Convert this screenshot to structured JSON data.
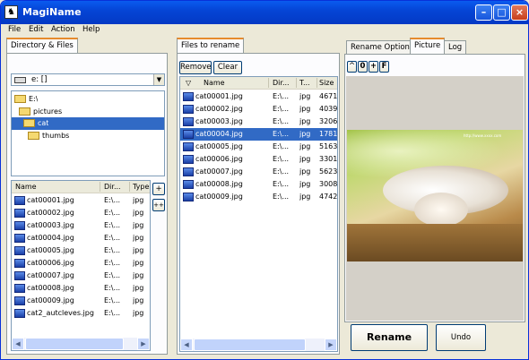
{
  "window": {
    "title": "MagiName"
  },
  "menu": [
    "File",
    "Edit",
    "Action",
    "Help"
  ],
  "left": {
    "tab": "Directory & Files",
    "drive": "e: []",
    "tree": [
      {
        "label": "E:\\"
      },
      {
        "label": "pictures"
      },
      {
        "label": "cat"
      },
      {
        "label": "thumbs"
      }
    ],
    "columns": [
      "Name",
      "Dir...",
      "Type"
    ],
    "files": [
      {
        "name": "cat00001.jpg",
        "dir": "E:\\...",
        "type": "jpg"
      },
      {
        "name": "cat00002.jpg",
        "dir": "E:\\...",
        "type": "jpg"
      },
      {
        "name": "cat00003.jpg",
        "dir": "E:\\...",
        "type": "jpg"
      },
      {
        "name": "cat00004.jpg",
        "dir": "E:\\...",
        "type": "jpg"
      },
      {
        "name": "cat00005.jpg",
        "dir": "E:\\...",
        "type": "jpg"
      },
      {
        "name": "cat00006.jpg",
        "dir": "E:\\...",
        "type": "jpg"
      },
      {
        "name": "cat00007.jpg",
        "dir": "E:\\...",
        "type": "jpg"
      },
      {
        "name": "cat00008.jpg",
        "dir": "E:\\...",
        "type": "jpg"
      },
      {
        "name": "cat00009.jpg",
        "dir": "E:\\...",
        "type": "jpg"
      },
      {
        "name": "cat2_autcleves.jpg",
        "dir": "E:\\...",
        "type": "jpg"
      }
    ],
    "add": "+",
    "add_all": "++"
  },
  "middle": {
    "tab": "Files to rename",
    "remove": "Remove",
    "clear": "Clear",
    "columns": [
      "Name",
      "Dir...",
      "T...",
      "Size"
    ],
    "files": [
      {
        "name": "cat00001.jpg",
        "dir": "E:\\...",
        "type": "jpg",
        "size": "4671"
      },
      {
        "name": "cat00002.jpg",
        "dir": "E:\\...",
        "type": "jpg",
        "size": "4039"
      },
      {
        "name": "cat00003.jpg",
        "dir": "E:\\...",
        "type": "jpg",
        "size": "3206"
      },
      {
        "name": "cat00004.jpg",
        "dir": "E:\\...",
        "type": "jpg",
        "size": "1781"
      },
      {
        "name": "cat00005.jpg",
        "dir": "E:\\...",
        "type": "jpg",
        "size": "5163"
      },
      {
        "name": "cat00006.jpg",
        "dir": "E:\\...",
        "type": "jpg",
        "size": "3301"
      },
      {
        "name": "cat00007.jpg",
        "dir": "E:\\...",
        "type": "jpg",
        "size": "5623"
      },
      {
        "name": "cat00008.jpg",
        "dir": "E:\\...",
        "type": "jpg",
        "size": "3008"
      },
      {
        "name": "cat00009.jpg",
        "dir": "E:\\...",
        "type": "jpg",
        "size": "4742"
      }
    ]
  },
  "right": {
    "tabs": [
      "Rename Option",
      "Picture",
      "Log"
    ],
    "zoom": [
      "^",
      "0",
      "+",
      "F"
    ],
    "watermark": "http://www.xxxx.com",
    "rename": "Rename",
    "undo": "Undo"
  }
}
